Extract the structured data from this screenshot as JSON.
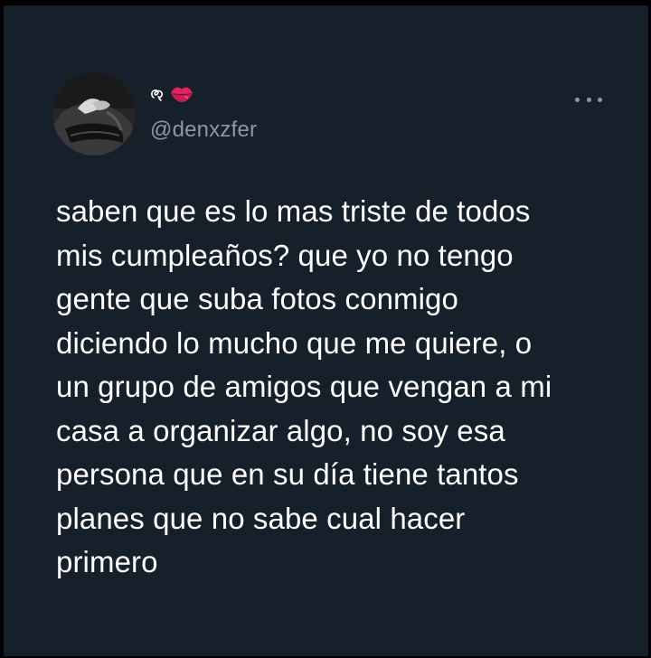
{
  "tweet": {
    "author": {
      "display_name_icons": [
        "pretzel-glyph-icon",
        "kiss-lips-icon"
      ],
      "handle": "@denxzfer"
    },
    "menu_icon": "more-options-icon",
    "text_lines": [
      "saben que es lo mas triste de todos",
      "mis cumpleaños? que yo no tengo",
      "gente que suba fotos conmigo",
      "diciendo lo mucho que me quiere, o",
      "un grupo de amigos que vengan a mi",
      "casa a organizar algo, no soy esa",
      "persona que en su día tiene tantos",
      "planes que no sabe cual hacer",
      "primero"
    ]
  },
  "colors": {
    "background": "#15202b",
    "text": "#ffffff",
    "secondary_text": "#8b98a5",
    "lips": "#e0245e"
  }
}
